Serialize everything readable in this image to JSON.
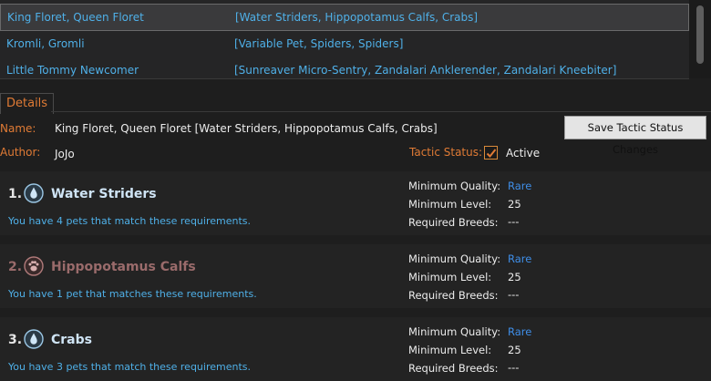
{
  "list": {
    "rows": [
      {
        "name": "King Floret, Queen Floret",
        "pets": "[Water Striders, Hippopotamus Calfs, Crabs]"
      },
      {
        "name": "Kromli, Gromli",
        "pets": "[Variable Pet, Spiders, Spiders]"
      },
      {
        "name": "Little Tommy Newcomer",
        "pets": "[Sunreaver Micro-Sentry, Zandalari Anklerender, Zandalari Kneebiter]"
      }
    ]
  },
  "details": {
    "tab_label": "Details",
    "name_label": "Name:",
    "name_value": "King Floret, Queen Floret [Water Striders, Hippopotamus Calfs, Crabs]",
    "author_label": "Author:",
    "author_value": "JoJo",
    "save_button": "Save Tactic Status Changes",
    "tactic_status_label": "Tactic Status:",
    "tactic_status_checked": true,
    "tactic_status_value": "Active"
  },
  "requirements": [
    {
      "number": "1.",
      "name": "Water Striders",
      "icon": "water-drop-icon",
      "match_text": "You have 4 pets that match these requirements.",
      "min_quality_label": "Minimum Quality:",
      "min_quality": "Rare",
      "min_level_label": "Minimum Level:",
      "min_level": "25",
      "breeds_label": "Required Breeds:",
      "breeds": "---"
    },
    {
      "number": "2.",
      "name": "Hippopotamus Calfs",
      "icon": "paw-icon",
      "match_text": "You have 1 pet that matches these requirements.",
      "min_quality_label": "Minimum Quality:",
      "min_quality": "Rare",
      "min_level_label": "Minimum Level:",
      "min_level": "25",
      "breeds_label": "Required Breeds:",
      "breeds": "---"
    },
    {
      "number": "3.",
      "name": "Crabs",
      "icon": "water-drop-icon",
      "match_text": "You have 3 pets that match these requirements.",
      "min_quality_label": "Minimum Quality:",
      "min_quality": "Rare",
      "min_level_label": "Minimum Level:",
      "min_level": "25",
      "breeds_label": "Required Breeds:",
      "breeds": "---"
    }
  ],
  "colors": {
    "accent_orange": "#e07b35",
    "link_blue": "#4fb0e8",
    "rare_blue": "#3f8ee8"
  }
}
